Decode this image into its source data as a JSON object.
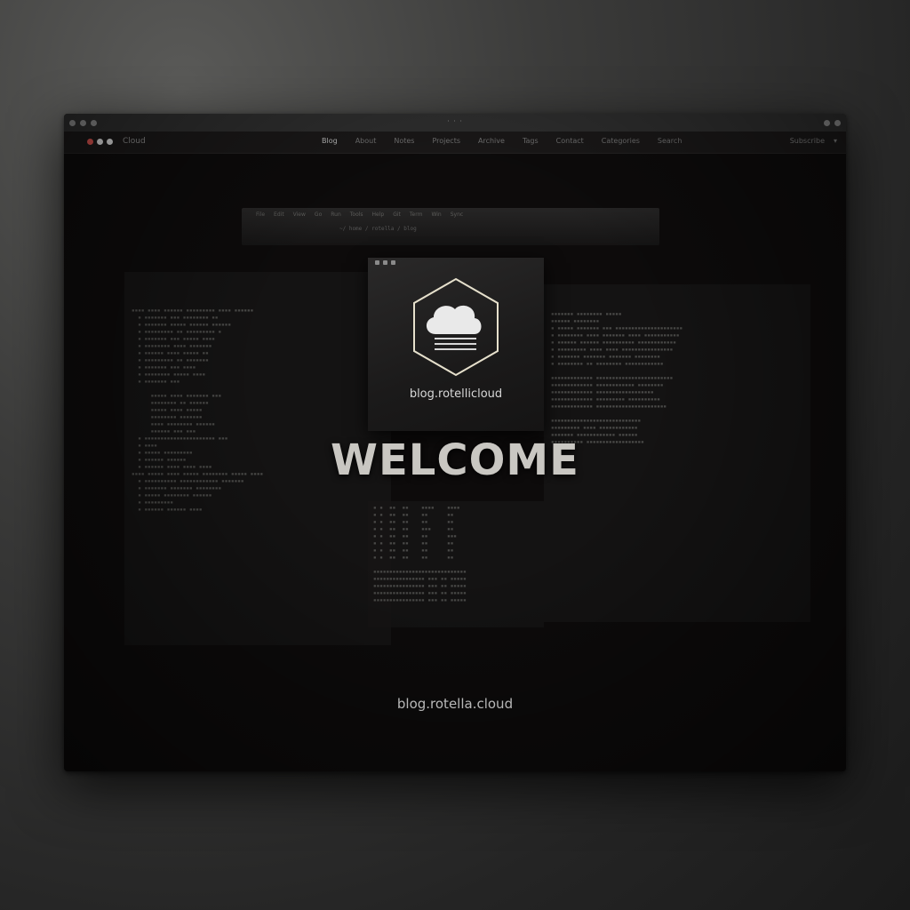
{
  "window": {
    "title": "· · ·"
  },
  "toolbar": {
    "brand": "Cloud",
    "nav": [
      "Blog",
      "About",
      "Notes",
      "Projects",
      "Archive",
      "Tags",
      "Contact",
      "Categories",
      "Search"
    ],
    "account": "Subscribe",
    "caret": "▾",
    "dot_colors": [
      "#d9534f",
      "#e0e0e0",
      "#e0e0e0"
    ]
  },
  "strip": {
    "items": [
      "File",
      "Edit",
      "View",
      "Go",
      "Run",
      "Tools",
      "Help",
      "Git",
      "Term",
      "Win",
      "Sync"
    ],
    "path": "~/ home / rotella / blog"
  },
  "logo_card": {
    "icon": "cloud-icon",
    "url": "blog.rotellicloud"
  },
  "main": {
    "headline": "WELCOME",
    "footer_url": "blog.rotella.cloud"
  },
  "colors": {
    "background": "#3c3c3b",
    "window": "#0d0b0b",
    "accent_red": "#d9534f",
    "text_light": "#e4e4e4"
  }
}
